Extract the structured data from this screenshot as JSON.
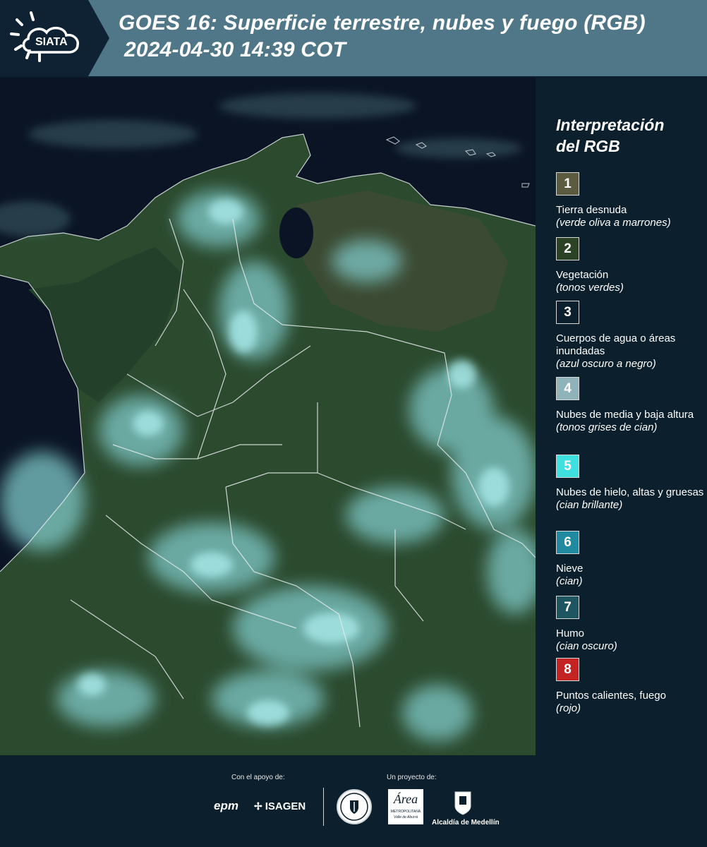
{
  "header": {
    "logo_text": "SIATA",
    "title_line1": "GOES 16: Superficie terrestre, nubes y fuego (RGB)",
    "title_line2": "2024-04-30 14:39 COT"
  },
  "legend": {
    "title_line1": "Interpretación",
    "title_line2": "del RGB",
    "items": [
      {
        "num": "1",
        "label": "Tierra desnuda",
        "sub": "(verde oliva a marrones)",
        "color": "#5b5b40"
      },
      {
        "num": "2",
        "label": "Vegetación",
        "sub": "(tonos verdes)",
        "color": "#2b4224"
      },
      {
        "num": "3",
        "label": "Cuerpos de agua o áreas inundadas",
        "sub": "(azul oscuro a negro)",
        "color": "#0b1f2c"
      },
      {
        "num": "4",
        "label": "Nubes de media y baja altura",
        "sub": "(tonos grises de cian)",
        "color": "#8fb3b8"
      },
      {
        "num": "5",
        "label": "Nubes de hielo, altas y gruesas",
        "sub": "(cian brillante)",
        "color": "#3ee0e0"
      },
      {
        "num": "6",
        "label": "Nieve",
        "sub": "(cian)",
        "color": "#1f8aa0"
      },
      {
        "num": "7",
        "label": "Humo",
        "sub": "(cian oscuro)",
        "color": "#1d5560"
      },
      {
        "num": "8",
        "label": "Puntos calientes, fuego",
        "sub": "(rojo)",
        "color": "#c42323"
      }
    ]
  },
  "footer": {
    "support_label": "Con el apoyo de:",
    "project_label": "Un proyecto de:",
    "sponsor_epm": "epm",
    "sponsor_isagen": "ISAGEN",
    "area_word": "Área",
    "area_sub1": "METROPOLITANA",
    "area_sub2": "Valle de Aburrá",
    "medellin": "Alcaldía de Medellín"
  },
  "colors": {
    "header_bg": "#4f7787",
    "logo_bg": "#0e2233",
    "page_bg": "#0b1f2c",
    "vegetation": "#2c4a30",
    "cloud": "#8fd6d6"
  }
}
